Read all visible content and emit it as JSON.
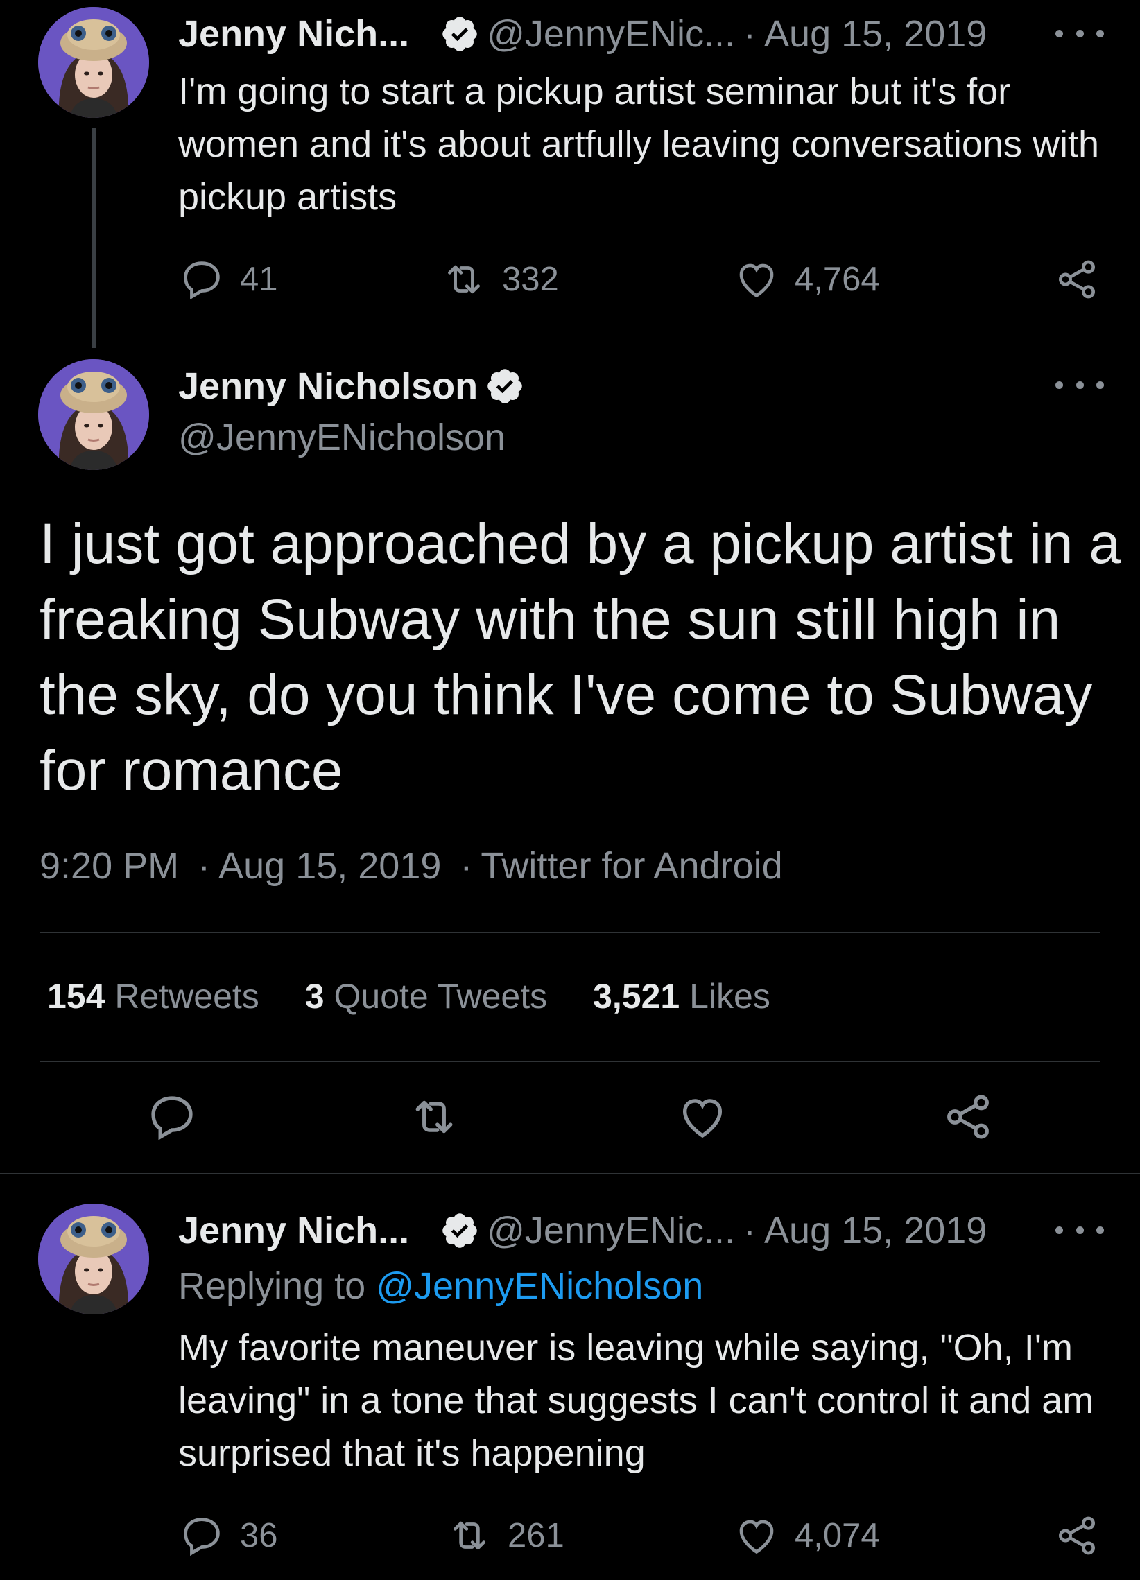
{
  "colors": {
    "background": "#000000",
    "text": "#e7e9ea",
    "muted": "#8b9198",
    "link": "#1d9bf0",
    "divider": "#2f3336",
    "avatar_bg": "#6a55c2"
  },
  "icons": {
    "verified": "verified-badge-icon",
    "more": "more-options-icon",
    "reply": "reply-icon",
    "retweet": "retweet-icon",
    "like": "heart-icon",
    "share": "share-icon"
  },
  "tweet1": {
    "name": "Jenny Nich...",
    "handle": "@JennyENic...",
    "date": "Aug 15, 2019",
    "separator": "·",
    "text": "I'm going to start a pickup artist seminar but it's for women and it's about artfully leaving conversations with pickup artists",
    "replies": "41",
    "retweets": "332",
    "likes": "4,764"
  },
  "main_tweet": {
    "name": "Jenny Nicholson",
    "handle": "@JennyENicholson",
    "text": "I just got approached by a pickup artist in a freaking Subway with the sun still high in the sky, do you think I've come to Subway for romance",
    "time": "9:20 PM",
    "date": "Aug 15, 2019",
    "source": "Twitter for Android",
    "separator": "·",
    "stats": {
      "retweets_count": "154",
      "retweets_label": "Retweets",
      "quotes_count": "3",
      "quotes_label": "Quote Tweets",
      "likes_count": "3,521",
      "likes_label": "Likes"
    }
  },
  "tweet3": {
    "name": "Jenny Nich...",
    "handle": "@JennyENic...",
    "date": "Aug 15, 2019",
    "separator": "·",
    "replying_prefix": "Replying to",
    "replying_to": "@JennyENicholson",
    "text": "My favorite maneuver is leaving while saying, \"Oh, I'm leaving\" in a tone that suggests I can't control it and am surprised that it's happening",
    "replies": "36",
    "retweets": "261",
    "likes": "4,074"
  }
}
